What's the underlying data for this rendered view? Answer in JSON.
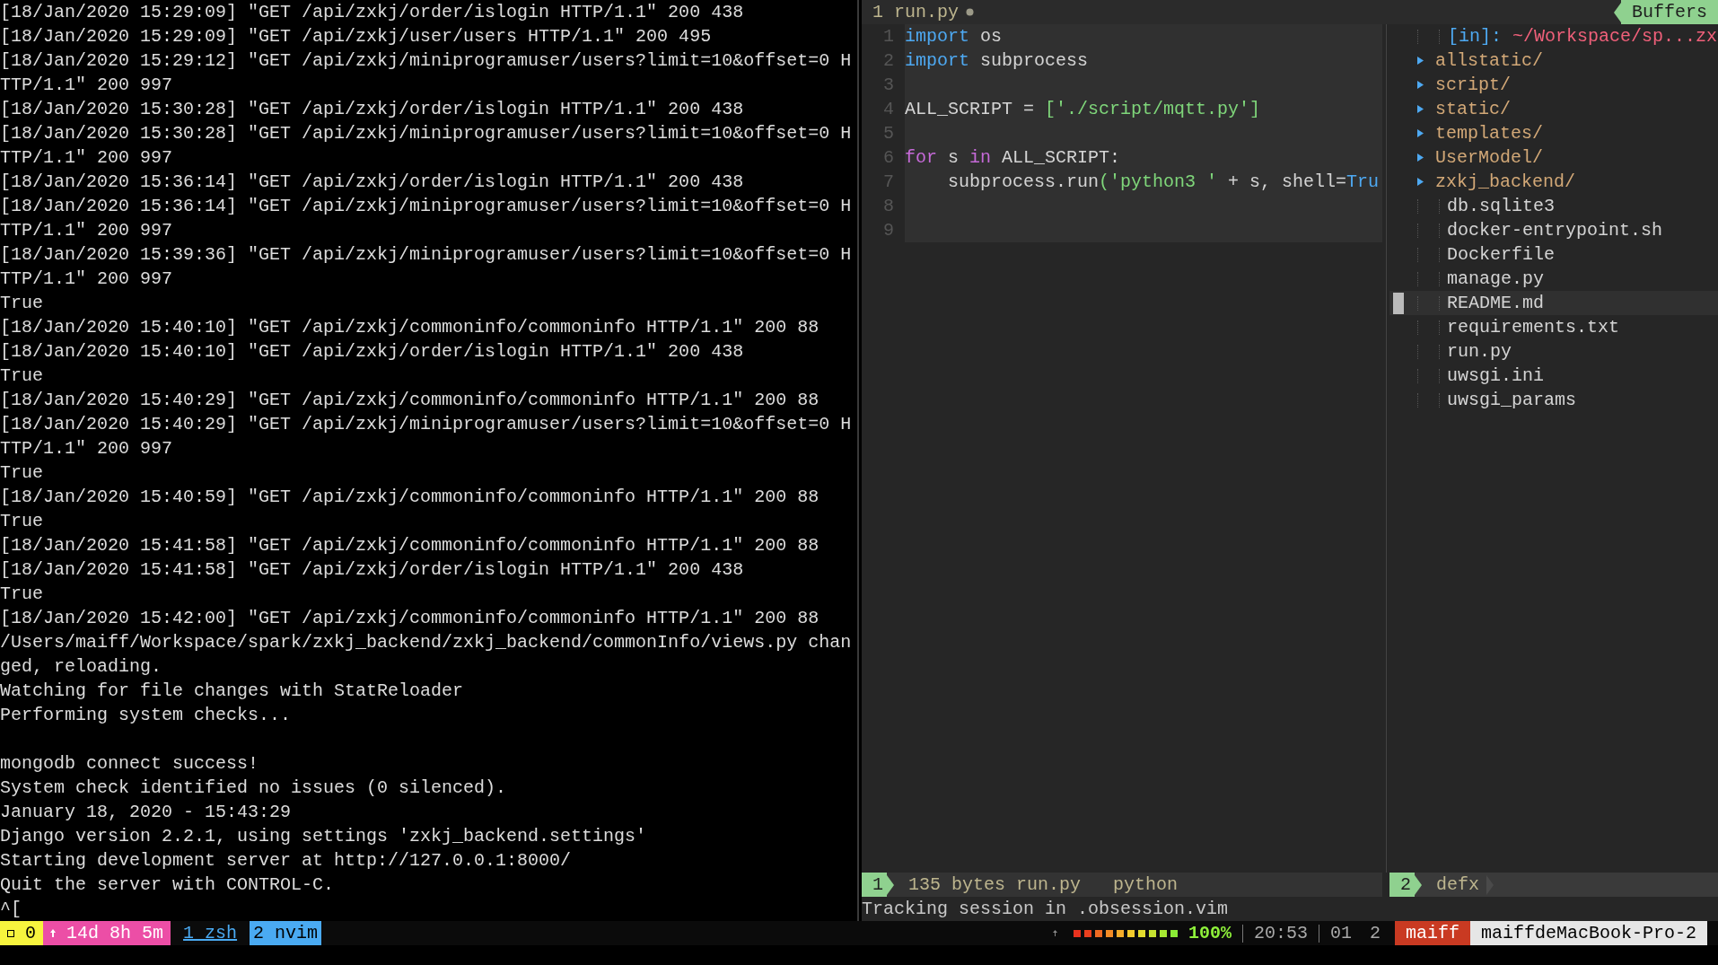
{
  "terminal": {
    "blocks": [
      {
        "lines": [
          "[18/Jan/2020 15:29:09] \"GET /api/zxkj/order/islogin HTTP/1.1\" 200 438",
          "[18/Jan/2020 15:29:09] \"GET /api/zxkj/user/users HTTP/1.1\" 200 495",
          "[18/Jan/2020 15:29:12] \"GET /api/zxkj/miniprogramuser/users?limit=10&offset=0 H",
          "TTP/1.1\" 200 997",
          "[18/Jan/2020 15:30:28] \"GET /api/zxkj/order/islogin HTTP/1.1\" 200 438",
          "[18/Jan/2020 15:30:28] \"GET /api/zxkj/miniprogramuser/users?limit=10&offset=0 H",
          "TTP/1.1\" 200 997",
          "[18/Jan/2020 15:36:14] \"GET /api/zxkj/order/islogin HTTP/1.1\" 200 438",
          "[18/Jan/2020 15:36:14] \"GET /api/zxkj/miniprogramuser/users?limit=10&offset=0 H",
          "TTP/1.1\" 200 997",
          "[18/Jan/2020 15:39:36] \"GET /api/zxkj/miniprogramuser/users?limit=10&offset=0 H",
          "TTP/1.1\" 200 997",
          "True",
          "[18/Jan/2020 15:40:10] \"GET /api/zxkj/commoninfo/commoninfo HTTP/1.1\" 200 88",
          "[18/Jan/2020 15:40:10] \"GET /api/zxkj/order/islogin HTTP/1.1\" 200 438",
          "True",
          "[18/Jan/2020 15:40:29] \"GET /api/zxkj/commoninfo/commoninfo HTTP/1.1\" 200 88",
          "[18/Jan/2020 15:40:29] \"GET /api/zxkj/miniprogramuser/users?limit=10&offset=0 H",
          "TTP/1.1\" 200 997",
          "True",
          "[18/Jan/2020 15:40:59] \"GET /api/zxkj/commoninfo/commoninfo HTTP/1.1\" 200 88",
          "True",
          "[18/Jan/2020 15:41:58] \"GET /api/zxkj/commoninfo/commoninfo HTTP/1.1\" 200 88",
          "[18/Jan/2020 15:41:58] \"GET /api/zxkj/order/islogin HTTP/1.1\" 200 438",
          "True",
          "[18/Jan/2020 15:42:00] \"GET /api/zxkj/commoninfo/commoninfo HTTP/1.1\" 200 88",
          "/Users/maiff/Workspace/spark/zxkj_backend/zxkj_backend/commonInfo/views.py chan",
          "ged, reloading.",
          "Watching for file changes with StatReloader",
          "Performing system checks..."
        ]
      },
      {
        "lines": [
          "mongodb connect success!",
          "System check identified no issues (0 silenced).",
          "January 18, 2020 - 15:43:29",
          "Django version 2.2.1, using settings 'zxkj_backend.settings'",
          "Starting development server at http://127.0.0.1:8000/",
          "Quit the server with CONTROL-C.",
          "^["
        ]
      }
    ]
  },
  "editor": {
    "tabline": {
      "tab": "1 run.py",
      "modified": true,
      "buffers_label": "Buffers"
    },
    "code": [
      {
        "number": "1",
        "tokens": [
          {
            "kind": "include",
            "text": "import"
          },
          {
            "kind": "text",
            "text": " os"
          }
        ]
      },
      {
        "number": "2",
        "tokens": [
          {
            "kind": "include",
            "text": "import"
          },
          {
            "kind": "text",
            "text": " subprocess"
          }
        ]
      },
      {
        "number": "3"
      },
      {
        "number": "4",
        "tokens": [
          {
            "kind": "text",
            "text": "ALL_SCRIPT = "
          },
          {
            "kind": "string",
            "text": "['./script/mqtt.py']"
          }
        ]
      },
      {
        "number": "5"
      },
      {
        "number": "6",
        "tokens": [
          {
            "kind": "keyword",
            "text": "for"
          },
          {
            "kind": "text",
            "text": " s "
          },
          {
            "kind": "keyword",
            "text": "in"
          },
          {
            "kind": "text",
            "text": " ALL_SCRIPT:"
          }
        ]
      },
      {
        "number": "7",
        "tokens": [
          {
            "kind": "text",
            "text": "    subprocess.run"
          },
          {
            "kind": "string",
            "text": "('python3 '"
          },
          {
            "kind": "text",
            "text": " + s, shell="
          },
          {
            "kind": "boolean",
            "text": "Tru"
          }
        ]
      },
      {
        "number": "8"
      },
      {
        "number": "9"
      }
    ],
    "defx": {
      "header_prefix": "[in]:",
      "header_path": "~/Workspace/sp...zx",
      "items": [
        {
          "kind": "dir",
          "name": "allstatic/",
          "selected": false
        },
        {
          "kind": "dir",
          "name": "script/",
          "selected": false
        },
        {
          "kind": "dir",
          "name": "static/",
          "selected": false
        },
        {
          "kind": "dir",
          "name": "templates/",
          "selected": false
        },
        {
          "kind": "dir",
          "name": "UserModel/",
          "selected": false
        },
        {
          "kind": "dir",
          "name": "zxkj_backend/",
          "selected": false
        },
        {
          "kind": "file",
          "name": "db.sqlite3",
          "selected": false
        },
        {
          "kind": "file",
          "name": "docker-entrypoint.sh",
          "selected": false
        },
        {
          "kind": "file",
          "name": "Dockerfile",
          "selected": false
        },
        {
          "kind": "file",
          "name": "manage.py",
          "selected": false
        },
        {
          "kind": "file",
          "name": "README.md",
          "selected": true
        },
        {
          "kind": "file",
          "name": "requirements.txt",
          "selected": false
        },
        {
          "kind": "file",
          "name": "run.py",
          "selected": false
        },
        {
          "kind": "file",
          "name": "uwsgi.ini",
          "selected": false
        },
        {
          "kind": "file",
          "name": "uwsgi_params",
          "selected": false
        }
      ]
    },
    "statusline": {
      "left": {
        "number": "1",
        "info": "135 bytes run.py",
        "filetype": "python"
      },
      "right": {
        "number": "2",
        "name": "defx"
      }
    },
    "command_line": "Tracking session in .obsession.vim"
  },
  "tmux": {
    "session": "0",
    "uptime": "14d 8h 5m",
    "windows": [
      {
        "label": "1 zsh",
        "selected": false
      },
      {
        "label": "2 nvim",
        "selected": true
      }
    ],
    "battery": {
      "reading": "100%"
    },
    "time": "20:53",
    "date": "01",
    "pane": "2",
    "user": "maiff",
    "host": "maiffdeMacBook-Pro-2"
  }
}
